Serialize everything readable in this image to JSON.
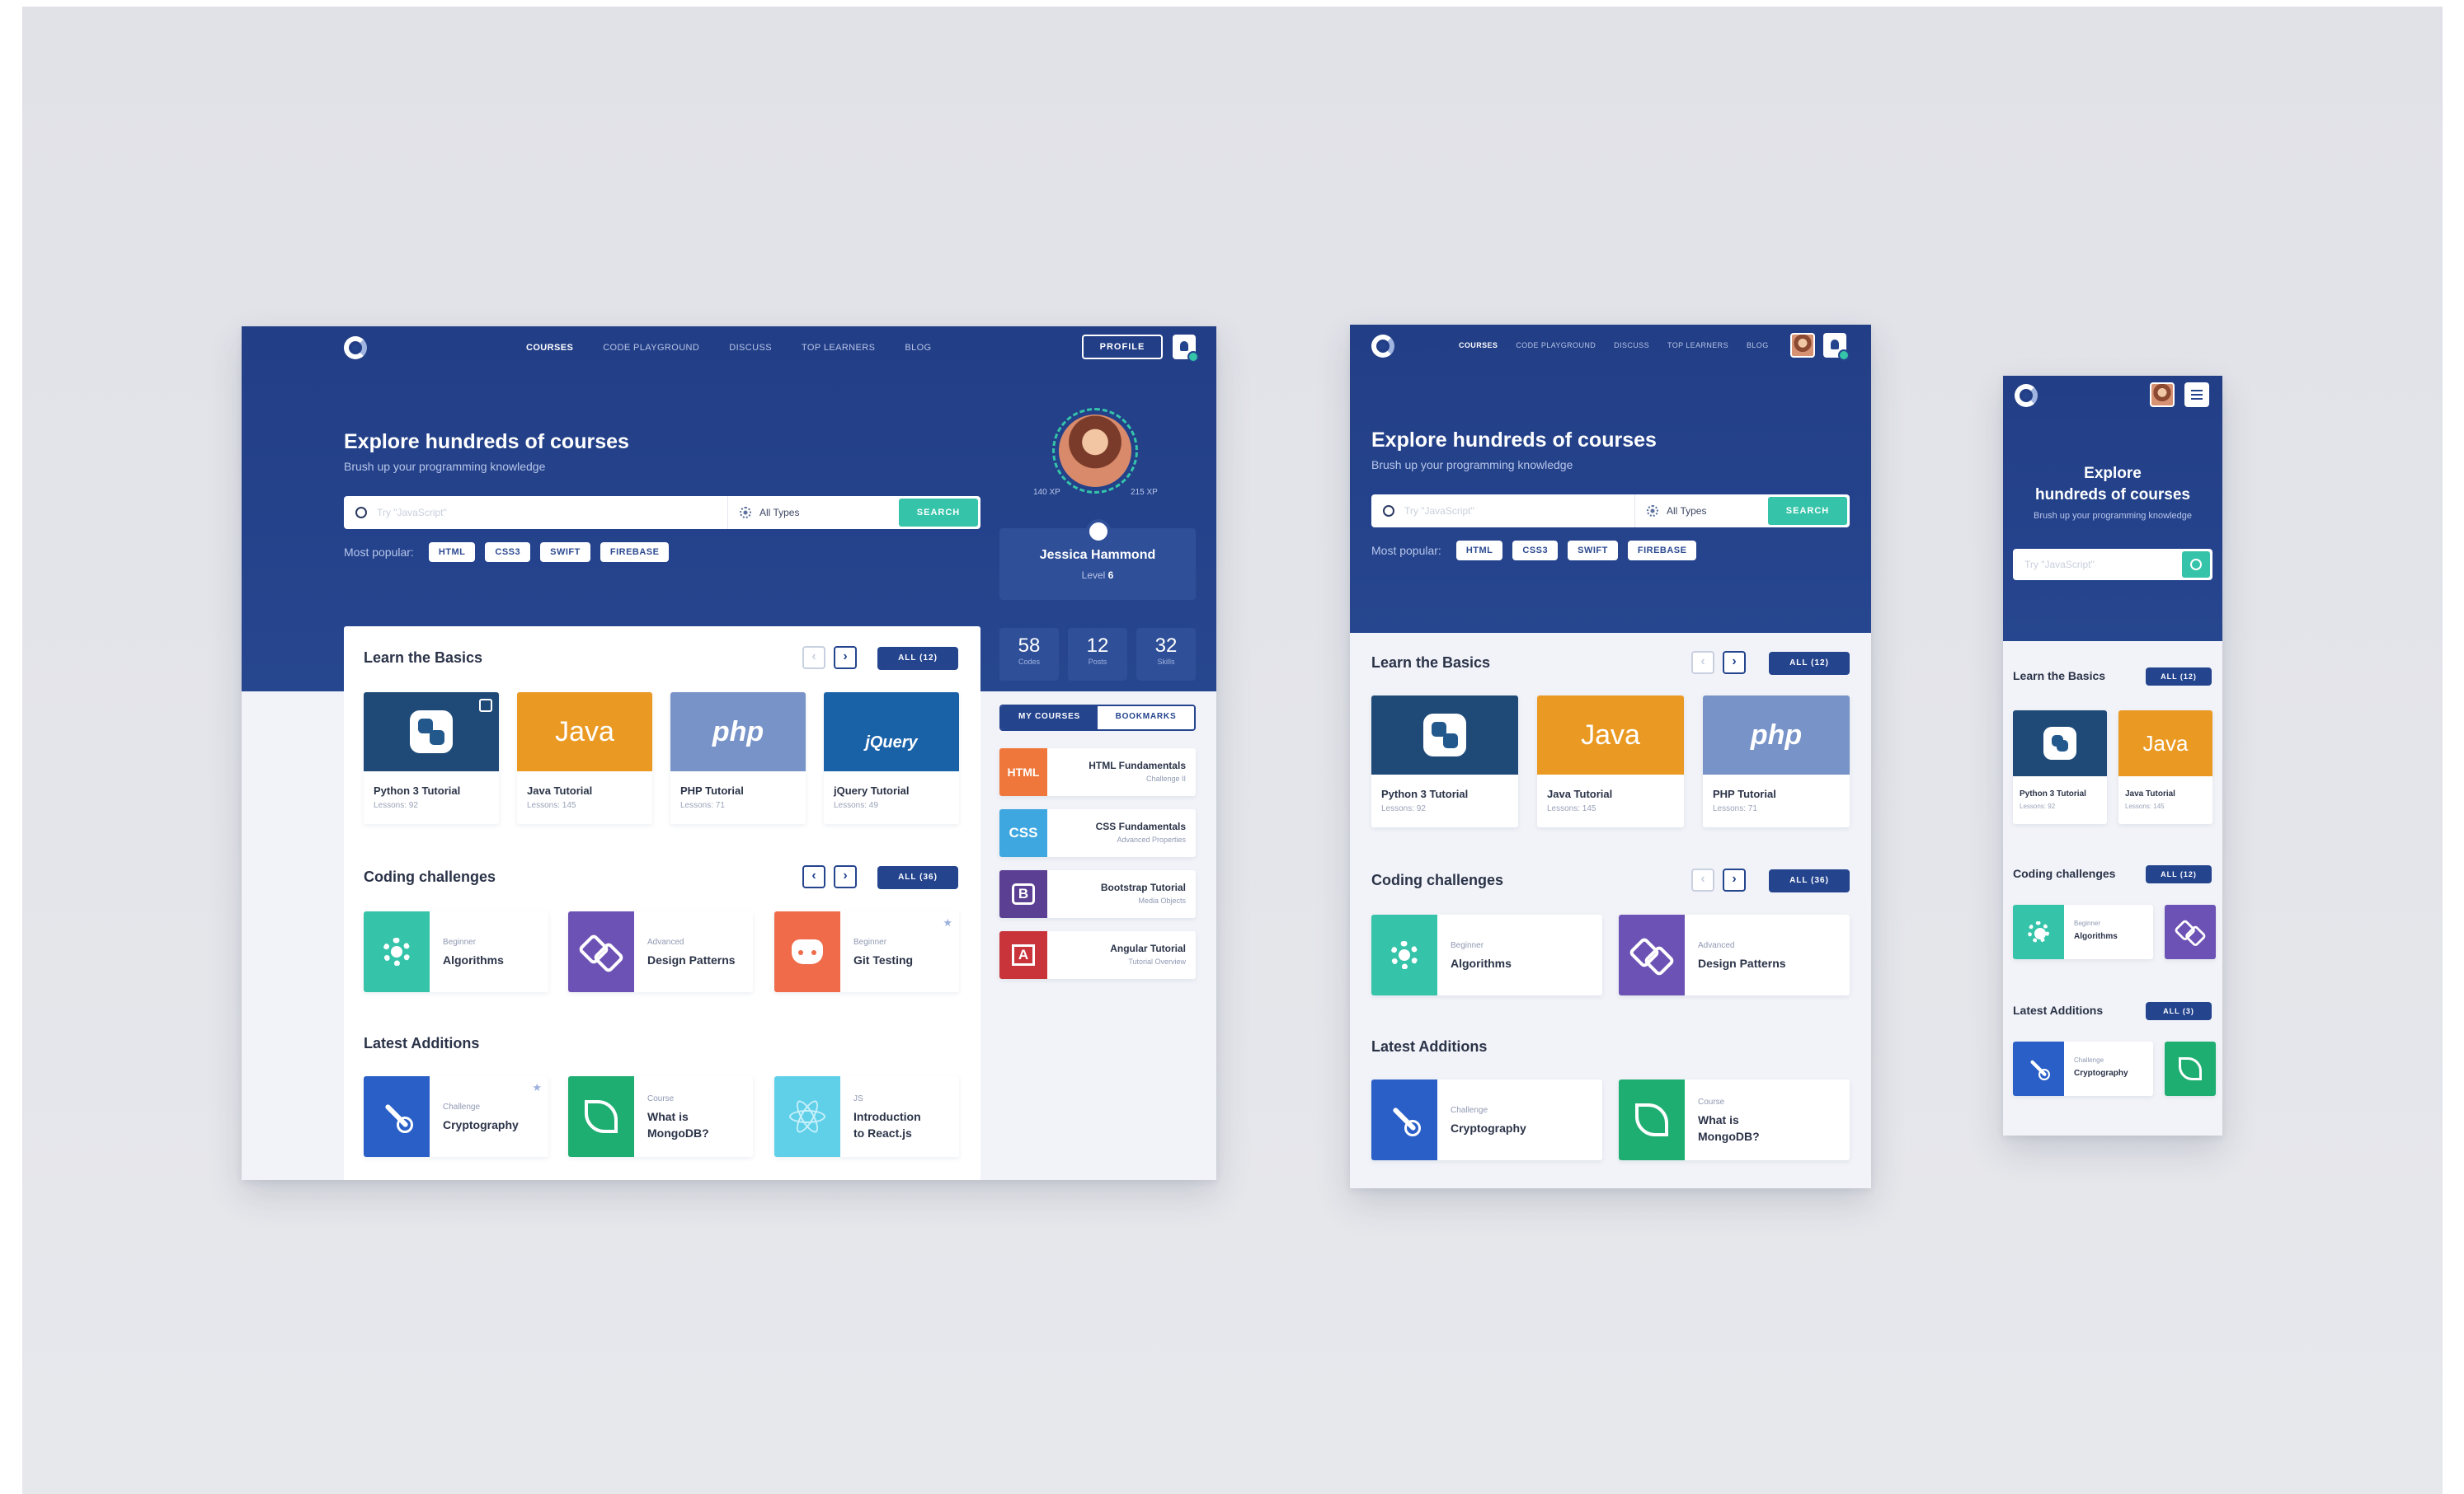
{
  "nav": {
    "items": [
      "COURSES",
      "CODE PLAYGROUND",
      "DISCUSS",
      "TOP LEARNERS",
      "BLOG"
    ],
    "profile_button": "PROFILE"
  },
  "hero": {
    "title": "Explore hundreds of courses",
    "title_line1": "Explore",
    "title_line2": "hundreds of courses",
    "subtitle": "Brush up your programming knowledge",
    "search_placeholder": "Try \"JavaScript\"",
    "type_filter": "All Types",
    "search_button": "SEARCH",
    "popular_label": "Most popular:",
    "popular_tags": [
      "HTML",
      "CSS3",
      "SWIFT",
      "FIREBASE"
    ]
  },
  "user": {
    "name": "Jessica Hammond",
    "level_label": "Level",
    "level": "6",
    "xp_left": "140 XP",
    "xp_right": "215 XP",
    "stats": [
      {
        "value": "58",
        "label": "Codes"
      },
      {
        "value": "12",
        "label": "Posts"
      },
      {
        "value": "32",
        "label": "Skills"
      }
    ],
    "tabs": [
      "MY COURSES",
      "BOOKMARKS"
    ],
    "bookmarks": [
      {
        "badge": "HTML",
        "title": "HTML Fundamentals",
        "sub": "Challenge II",
        "color": "#f0773b"
      },
      {
        "badge": "CSS",
        "title": "CSS Fundamentals",
        "sub": "Advanced Properties",
        "color": "#3ea7e0"
      },
      {
        "badge": "B",
        "title": "Bootstrap Tutorial",
        "sub": "Media Objects",
        "color": "#5a3f93"
      },
      {
        "badge": "A",
        "title": "Angular Tutorial",
        "sub": "Tutorial Overview",
        "color": "#c9343a"
      }
    ]
  },
  "basics": {
    "title": "Learn the Basics",
    "all_label": "ALL (12)",
    "courses": [
      {
        "logo": "python",
        "title": "Python 3 Tutorial",
        "lessons": "Lessons: 92",
        "color": "#1f4a77"
      },
      {
        "logo": "Java",
        "title": "Java Tutorial",
        "lessons": "Lessons: 145",
        "color": "#ea9a23"
      },
      {
        "logo": "php",
        "title": "PHP Tutorial",
        "lessons": "Lessons: 71",
        "color": "#7893c8"
      },
      {
        "logo": "jQuery",
        "title": "jQuery Tutorial",
        "lessons": "Lessons: 49",
        "color": "#1a62a8"
      }
    ]
  },
  "challenges": {
    "title": "Coding challenges",
    "all_label": "ALL (36)",
    "all_label_mobile": "ALL (12)",
    "items": [
      {
        "level": "Beginner",
        "name": "Algorithms",
        "color": "#35c4a9"
      },
      {
        "level": "Advanced",
        "name": "Design Patterns",
        "color": "#6d52b5"
      },
      {
        "level": "Beginner",
        "name": "Git Testing",
        "color": "#ef6b4a"
      }
    ]
  },
  "additions": {
    "title": "Latest Additions",
    "all_label_mobile": "ALL (3)",
    "items": [
      {
        "kind": "Challenge",
        "line1": "Cryptography",
        "line2": "",
        "color": "#2a5fc8"
      },
      {
        "kind": "Course",
        "line1": "What is",
        "line2": "MongoDB?",
        "color": "#1fae72"
      },
      {
        "kind": "JS",
        "line1": "Introduction",
        "line2": "to React.js",
        "color": "#5fd0e8"
      }
    ]
  },
  "colors": {
    "primary": "#24448e",
    "accent": "#35c4a9",
    "background": "#f1f3f8"
  },
  "icons": [
    "logo-icon",
    "bell-icon",
    "search-icon",
    "filter-icon",
    "star-icon",
    "chevron-left-icon",
    "chevron-right-icon",
    "menu-icon"
  ]
}
